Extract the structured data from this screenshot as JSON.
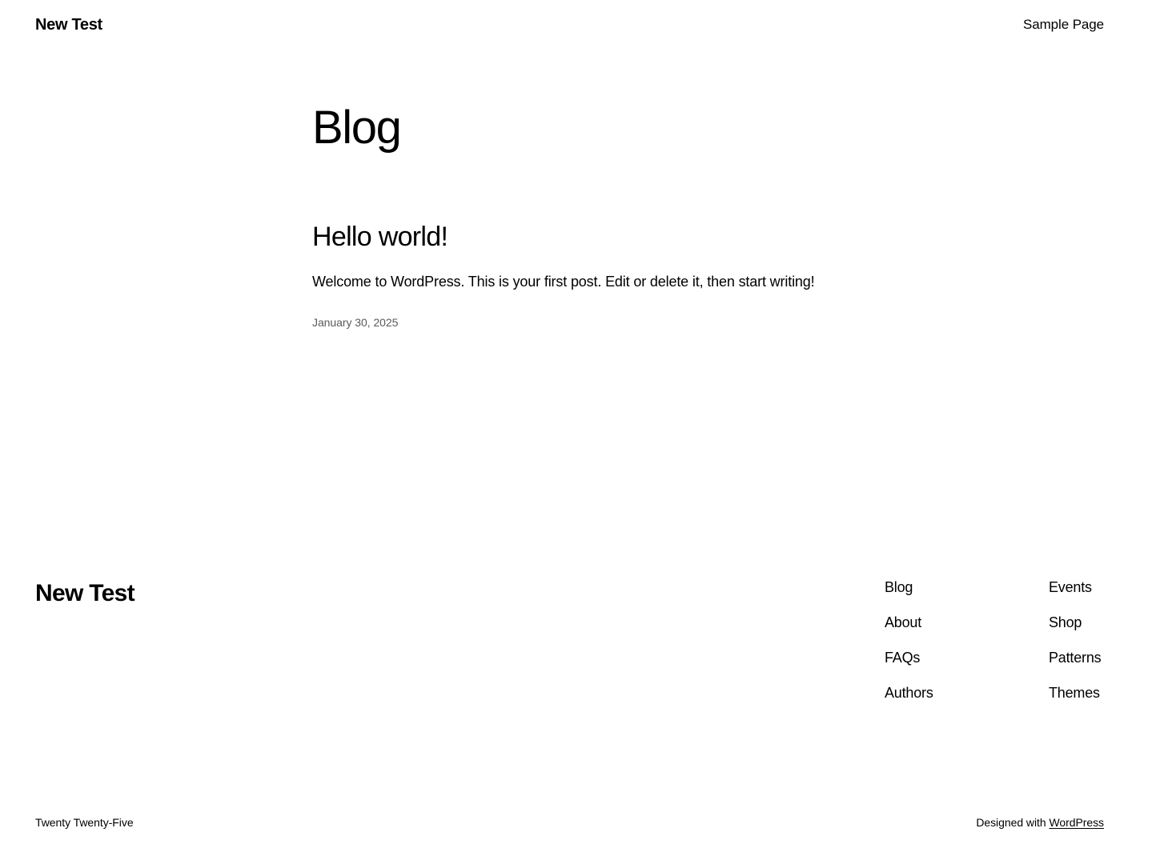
{
  "colors": {
    "background": "#ffffff",
    "text": "#000000",
    "muted_text": "#5a5a5a"
  },
  "header": {
    "site_title": "New Test",
    "nav_items": [
      {
        "label": "Sample Page"
      }
    ]
  },
  "main": {
    "archive_title": "Blog",
    "posts": [
      {
        "title": "Hello world!",
        "excerpt": "Welcome to WordPress. This is your first post. Edit or delete it, then start writing!",
        "date": "January 30, 2025"
      }
    ]
  },
  "footer": {
    "site_title": "New Test",
    "nav_columns": [
      {
        "items": [
          {
            "label": "Blog"
          },
          {
            "label": "About"
          },
          {
            "label": "FAQs"
          },
          {
            "label": "Authors"
          }
        ]
      },
      {
        "items": [
          {
            "label": "Events"
          },
          {
            "label": "Shop"
          },
          {
            "label": "Patterns"
          },
          {
            "label": "Themes"
          }
        ]
      }
    ],
    "bottom_bar": {
      "theme_name": "Twenty Twenty-Five",
      "credit_prefix": "Designed with ",
      "credit_link": "WordPress"
    }
  }
}
